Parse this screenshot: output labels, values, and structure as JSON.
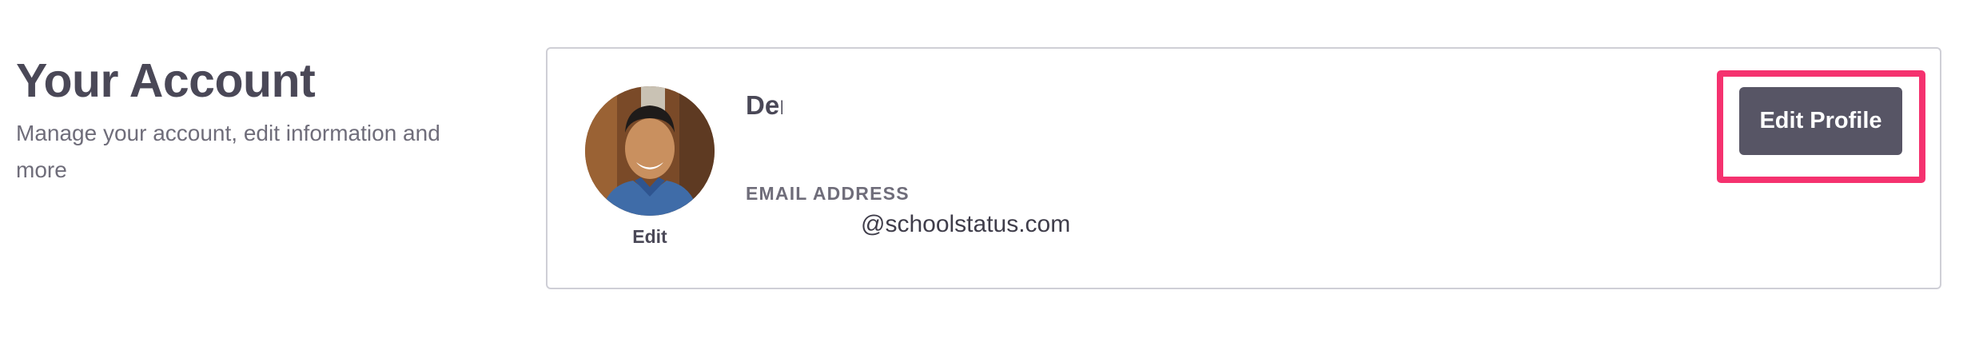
{
  "intro": {
    "title": "Your Account",
    "subtitle": "Manage your account, edit information and more"
  },
  "profile": {
    "avatar_edit_label": "Edit",
    "name": "Den",
    "email_label": "EMAIL ADDRESS",
    "email_value": "@schoolstatus.com",
    "edit_profile_label": "Edit Profile"
  },
  "colors": {
    "button": "#575565",
    "highlight": "#f5326f",
    "heading": "#4a4857"
  }
}
